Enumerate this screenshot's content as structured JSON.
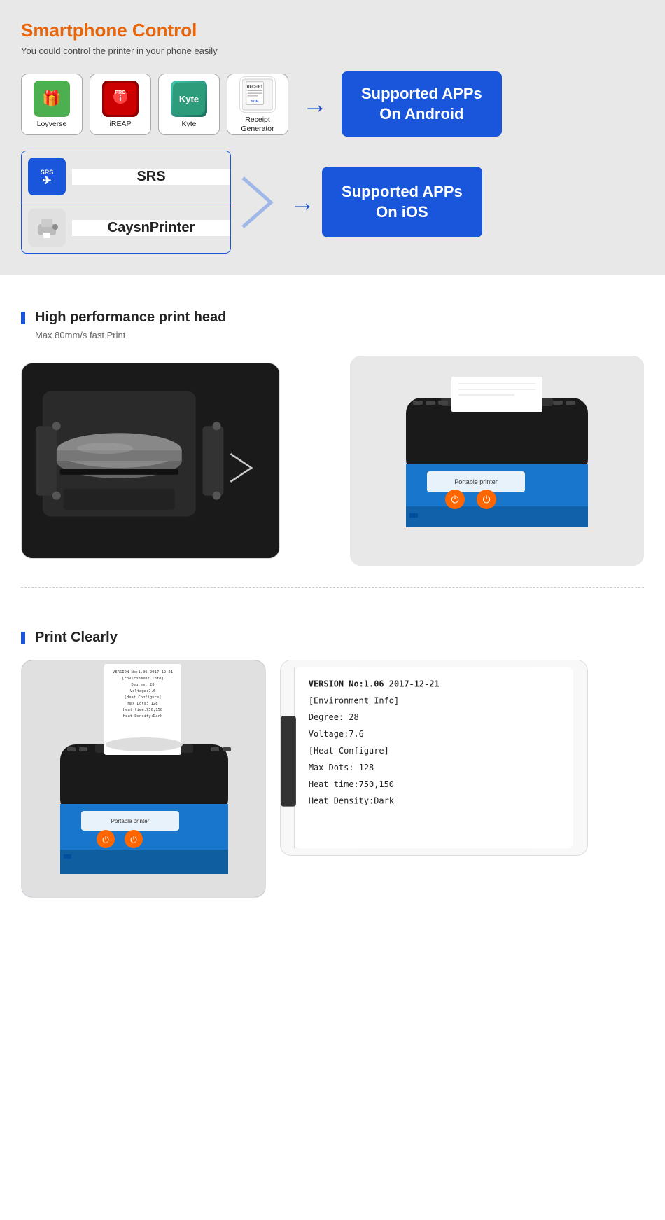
{
  "section1": {
    "title": "Smartphone Control",
    "subtitle": "You could control the printer in your phone easily",
    "android_apps": [
      {
        "name": "Loyverse",
        "icon_type": "loyverse"
      },
      {
        "name": "iREAP",
        "icon_type": "ireap"
      },
      {
        "name": "Kyte",
        "icon_type": "kyte"
      },
      {
        "name": "Receipt\nGenerator",
        "icon_type": "receipt"
      }
    ],
    "android_badge": "Supported APPs\nOn Android",
    "ios_apps": [
      {
        "name": "SRS",
        "icon_type": "srs"
      },
      {
        "name": "CaysnPrinter",
        "icon_type": "caysnprinter"
      }
    ],
    "ios_badge": "Supported APPs\nOn iOS"
  },
  "section2": {
    "feature_title": "High performance print head",
    "feature_subtitle": "Max 80mm/s fast Print"
  },
  "section3": {
    "feature_title": "Print Clearly",
    "receipt_lines": [
      "VERSION No:1.06 2017-12-21",
      "[Environment Info]",
      "Degree: 28",
      "Voltage: 7.6",
      "[Heat Configure]",
      "Max Dots: 128",
      "Heat time:750,150",
      "Heat Density:Dark"
    ]
  }
}
